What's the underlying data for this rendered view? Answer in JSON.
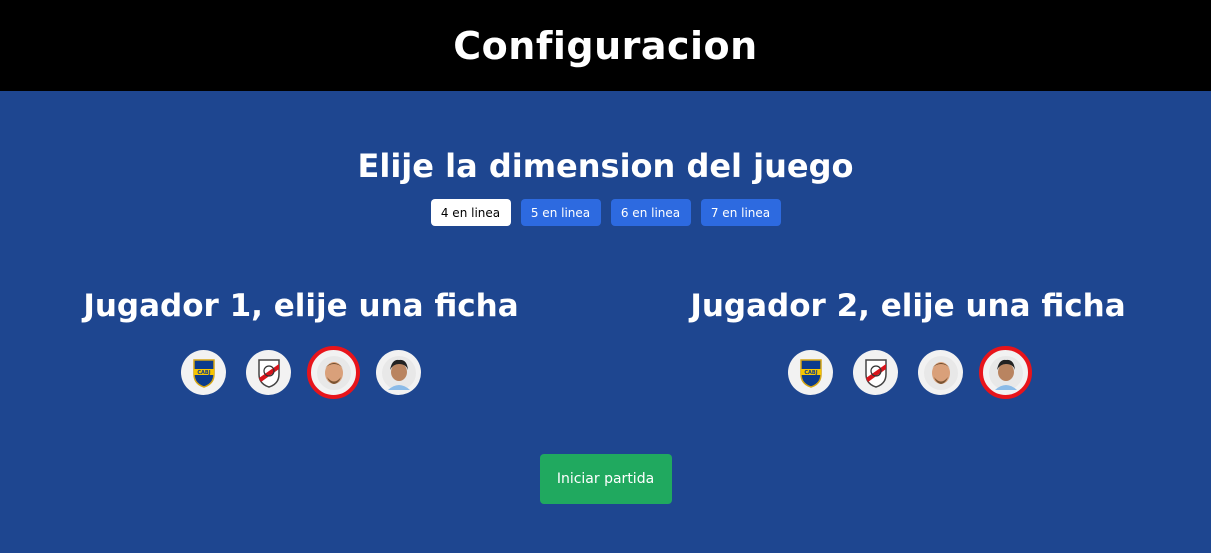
{
  "header": {
    "title": "Configuracion"
  },
  "dimension": {
    "heading": "Elije la dimension del juego",
    "options": [
      {
        "label": "4 en linea",
        "selected": true
      },
      {
        "label": "5 en linea",
        "selected": false
      },
      {
        "label": "6 en linea",
        "selected": false
      },
      {
        "label": "7 en linea",
        "selected": false
      }
    ]
  },
  "players": [
    {
      "heading": "Jugador 1, elije una ficha",
      "fichas": [
        {
          "icon": "boca-juniors-crest-icon",
          "selected": false
        },
        {
          "icon": "river-plate-crest-icon",
          "selected": false
        },
        {
          "icon": "messi-face-icon",
          "selected": true
        },
        {
          "icon": "maradona-face-icon",
          "selected": false
        }
      ]
    },
    {
      "heading": "Jugador 2, elije una ficha",
      "fichas": [
        {
          "icon": "boca-juniors-crest-icon",
          "selected": false
        },
        {
          "icon": "river-plate-crest-icon",
          "selected": false
        },
        {
          "icon": "messi-face-icon",
          "selected": false
        },
        {
          "icon": "maradona-face-icon",
          "selected": true
        }
      ]
    }
  ],
  "start_button": {
    "label": "Iniciar partida"
  },
  "colors": {
    "background": "#1e4690",
    "header": "#000000",
    "dimension_button": "#2d6ae0",
    "start_button": "#20a95f",
    "selection_ring": "#e8141b"
  }
}
